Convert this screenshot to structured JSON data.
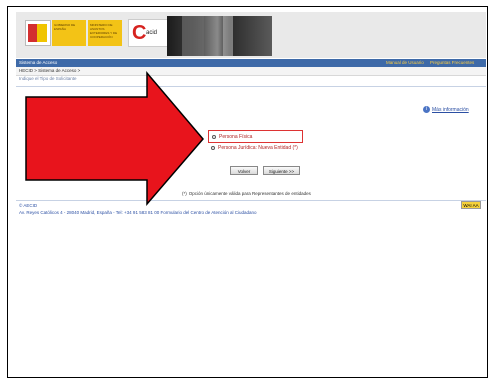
{
  "topnav": {
    "left_label": "Sistema de Acceso",
    "right_label_1": "Manual de Usuario",
    "right_label_2": "Preguntas Frecuentes"
  },
  "breadcrumb": {
    "label": "HECID > Sistema de Acceso >"
  },
  "page": {
    "subtitle": "Indique el Tipo de Solicitante",
    "info_link": "Más información"
  },
  "options": {
    "persona_fisica": "Persona Física",
    "persona_juridica": "Persona Jurídica: Nueva Entidad (*)"
  },
  "buttons": {
    "back": "Volver",
    "next": "Siguiente >>"
  },
  "note": {
    "mark": "(*)",
    "text": "Opción únicamente válida para Representantes de entidades"
  },
  "footer": {
    "org": "© AECID",
    "address": "Av. Reyes Católicos 4 - 28040 Madrid, España - Tel: +34 91 583 81 00 Formulario del Centro de Atención al Ciudadano"
  },
  "logos": {
    "cacid_letter": "C",
    "cacid_text": "acid",
    "ministerio1": "GOBIERNO DE ESPAÑA",
    "ministerio2": "MINISTERIO DE ASUNTOS EXTERIORES Y DE COOPERACIÓN",
    "wai_badge": "WAI AA"
  },
  "colors": {
    "header_bar": "#3e6aa8",
    "highlight_border": "#d33333",
    "arrow_fill": "#e8141c"
  }
}
